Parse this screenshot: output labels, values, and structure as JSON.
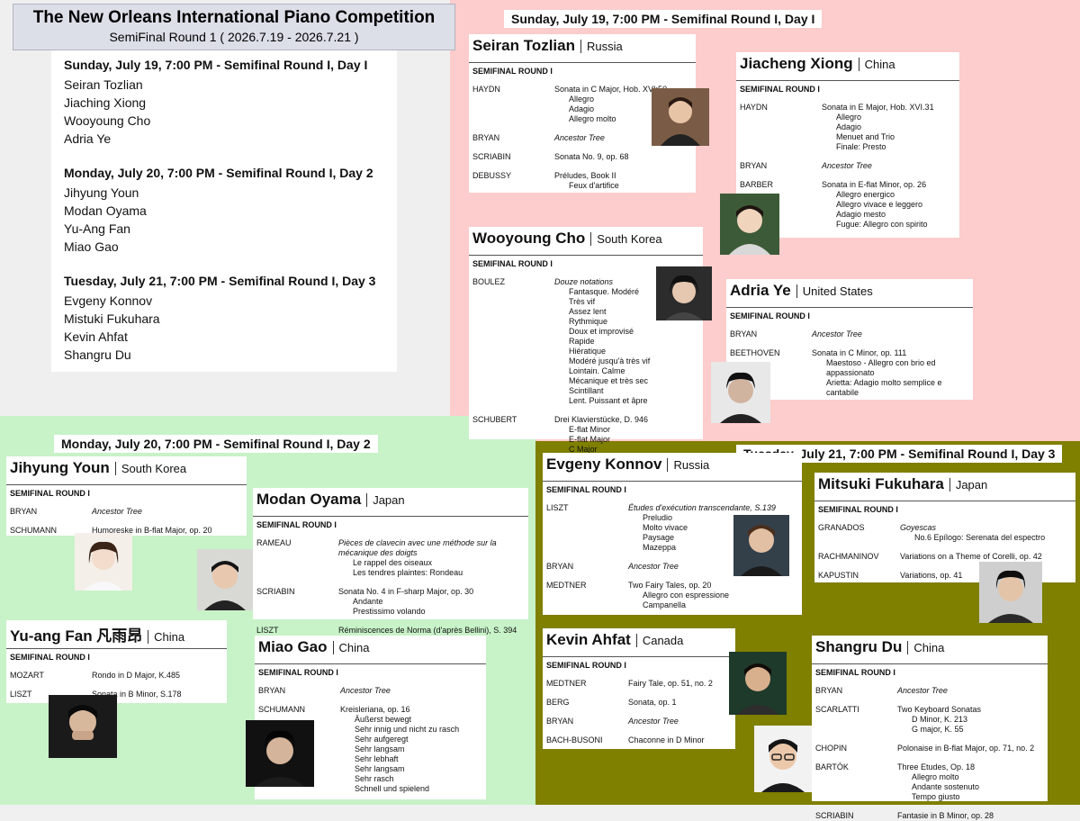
{
  "header": {
    "title": "The New Orleans International Piano Competition",
    "subtitle": "SemiFinal Round 1 ( 2026.7.19 - 2026.7.21 )"
  },
  "schedule": {
    "day1": {
      "heading": "Sunday, July 19, 7:00 PM - Semifinal Round I, Day I",
      "names": [
        "Seiran Tozlian",
        "Jiaching Xiong",
        "Wooyoung Cho",
        "Adria Ye"
      ]
    },
    "day2": {
      "heading": "Monday, July 20, 7:00 PM - Semifinal Round I, Day 2",
      "names": [
        "Jihyung Youn",
        "Modan Oyama",
        "Yu-Ang Fan",
        "Miao Gao"
      ]
    },
    "day3": {
      "heading": "Tuesday, July 21, 7:00 PM - Semifinal Round I, Day 3",
      "names": [
        "Evgeny Konnov",
        "Mistuki Fukuhara",
        "Kevin Ahfat",
        "Shangru Du"
      ]
    }
  },
  "banners": {
    "sunday": "Sunday, July 19, 7:00 PM - Semifinal Round I, Day I",
    "monday": "Monday, July 20, 7:00 PM - Semifinal Round I, Day 2",
    "tuesday": "Tuesday, July 21, 7:00 PM - Semifinal Round I, Day 3"
  },
  "round_label": "SEMIFINAL ROUND I",
  "colors": {
    "gray_zone": "#efefef",
    "pink_zone": "#fdcccc",
    "green_zone": "#c8f2c8",
    "olive_zone": "#7f7f00"
  },
  "cards": {
    "seiran": {
      "name": "Seiran Tozlian",
      "country": "Russia",
      "rows": [
        {
          "c": "HAYDN",
          "w": "Sonata in C Major, Hob. XVI:50",
          "m": [
            "Allegro",
            "Adagio",
            "Allegro molto"
          ]
        },
        {
          "c": "BRYAN",
          "w": "Ancestor Tree",
          "it": true,
          "m": []
        },
        {
          "c": "SCRIABIN",
          "w": "Sonata No. 9, op. 68",
          "m": []
        },
        {
          "c": "DEBUSSY",
          "w": "Préludes, Book II",
          "m": [
            "Feux d'artifice"
          ]
        }
      ]
    },
    "jiacheng": {
      "name": "Jiacheng Xiong",
      "country": "China",
      "rows": [
        {
          "c": "HAYDN",
          "w": "Sonata in E Major, Hob. XVI.31",
          "m": [
            "Allegro",
            "Adagio",
            "Menuet and Trio",
            "Finale: Presto"
          ]
        },
        {
          "c": "BRYAN",
          "w": "Ancestor Tree",
          "it": true,
          "m": []
        },
        {
          "c": "BARBER",
          "w": "Sonata in E-flat Minor, op. 26",
          "m": [
            "Allegro energico",
            "Allegro vivace e leggero",
            "Adagio mesto",
            "Fugue: Allegro con spirito"
          ]
        }
      ]
    },
    "wooyoung": {
      "name": "Wooyoung Cho",
      "country": "South Korea",
      "rows": [
        {
          "c": "BOULEZ",
          "w": "Douze notations",
          "it": true,
          "m": [
            "Fantasque. Modéré",
            "Très vif",
            "Assez lent",
            "Rythmique",
            "Doux et improvisé",
            "Rapide",
            "Hiératique",
            "Modéré jusqu'à très vif",
            "Lointain. Calme",
            "Mécanique et très sec",
            "Scintillant",
            "Lent. Puissant et âpre"
          ]
        },
        {
          "c": "SCHUBERT",
          "w": "Drei Klavierstücke, D. 946",
          "m": [
            "E-flat Minor",
            "E-flat Major",
            "C Major"
          ]
        }
      ]
    },
    "adria": {
      "name": "Adria Ye",
      "country": "United States",
      "rows": [
        {
          "c": "BRYAN",
          "w": "Ancestor Tree",
          "it": true,
          "m": []
        },
        {
          "c": "BEETHOVEN",
          "w": "Sonata in C Minor, op. 111",
          "m": [
            "Maestoso - Allegro con brio ed",
            "appassionato",
            "Arietta: Adagio molto semplice e",
            "cantabile"
          ]
        }
      ]
    },
    "jihyung": {
      "name": "Jihyung Youn",
      "country": "South Korea",
      "rows": [
        {
          "c": "BRYAN",
          "w": "Ancestor Tree",
          "it": true,
          "m": []
        },
        {
          "c": "SCHUMANN",
          "w": "Humoreske in B-flat Major, op. 20",
          "m": []
        }
      ]
    },
    "modan": {
      "name": "Modan Oyama",
      "country": "Japan",
      "rows": [
        {
          "c": "RAMEAU",
          "w": "Pièces de clavecin avec une méthode sur la mécanique des doigts",
          "it": true,
          "m": [
            "Le rappel des oiseaux",
            "Les tendres plaintes: Rondeau"
          ]
        },
        {
          "c": "SCRIABIN",
          "w": "Sonata No. 4 in F-sharp Major, op. 30",
          "m": [
            "Andante",
            "Prestissimo volando"
          ]
        },
        {
          "c": "LISZT",
          "w": "Réminiscences de Norma (d'après Bellini), S. 394",
          "m": []
        }
      ]
    },
    "yuang": {
      "name": "Yu-ang Fan",
      "cjk": "凡雨昂",
      "country": "China",
      "rows": [
        {
          "c": "MOZART",
          "w": "Rondo in D Major, K.485",
          "m": []
        },
        {
          "c": "LISZT",
          "w": "Sonata in B Minor, S.178",
          "m": []
        }
      ]
    },
    "miao": {
      "name": "Miao Gao",
      "country": "China",
      "rows": [
        {
          "c": "BRYAN",
          "w": "Ancestor Tree",
          "it": true,
          "m": []
        },
        {
          "c": "SCHUMANN",
          "w": "Kreisleriana, op. 16",
          "m": [
            "Äußerst bewegt",
            "Sehr innig und nicht zu rasch",
            "Sehr aufgeregt",
            "Sehr langsam",
            "Sehr lebhaft",
            "Sehr langsam",
            "Sehr rasch",
            "Schnell und spielend"
          ]
        }
      ]
    },
    "evgeny": {
      "name": "Evgeny Konnov",
      "country": "Russia",
      "rows": [
        {
          "c": "LISZT",
          "w": "Études d'exécution transcendante, S.139",
          "it": true,
          "m": [
            "Preludio",
            "Molto vivace",
            "Paysage",
            "Mazeppa"
          ]
        },
        {
          "c": "BRYAN",
          "w": "Ancestor Tree",
          "it": true,
          "m": []
        },
        {
          "c": "MEDTNER",
          "w": "Two Fairy Tales, op. 20",
          "m": [
            "Allegro con espressione",
            "Campanella"
          ]
        }
      ]
    },
    "mitsuki": {
      "name": "Mitsuki Fukuhara",
      "country": "Japan",
      "rows": [
        {
          "c": "GRANADOS",
          "w": "Goyescas",
          "it": true,
          "m": [
            "No.6 Epílogo: Serenata del espectro"
          ]
        },
        {
          "c": "RACHMANINOV",
          "w": "Variations on a Theme of Corelli, op. 42",
          "m": []
        },
        {
          "c": "KAPUSTIN",
          "w": "Variations, op. 41",
          "m": []
        }
      ]
    },
    "kevin": {
      "name": "Kevin Ahfat",
      "country": "Canada",
      "rows": [
        {
          "c": "MEDTNER",
          "w": "Fairy Tale, op. 51, no. 2",
          "m": []
        },
        {
          "c": "BERG",
          "w": "Sonata, op. 1",
          "m": []
        },
        {
          "c": "BRYAN",
          "w": "Ancestor Tree",
          "it": true,
          "m": []
        },
        {
          "c": "BACH-BUSONI",
          "w": "Chaconne in D Minor",
          "m": []
        }
      ]
    },
    "shangru": {
      "name": "Shangru Du",
      "country": "China",
      "rows": [
        {
          "c": "BRYAN",
          "w": "Ancestor Tree",
          "it": true,
          "m": []
        },
        {
          "c": "SCARLATTI",
          "w": "Two Keyboard Sonatas",
          "m": [
            "D Minor, K. 213",
            "G major, K. 55"
          ]
        },
        {
          "c": "CHOPIN",
          "w": "Polonaise in B-flat Major, op. 71, no. 2",
          "m": []
        },
        {
          "c": "BARTÓK",
          "w": "Three Etudes, Op. 18",
          "m": [
            "Allegro molto",
            "Andante sostenuto",
            "Tempo giusto"
          ]
        },
        {
          "c": "SCRIABIN",
          "w": "Fantasie in B Minor, op. 28",
          "m": []
        }
      ]
    }
  }
}
